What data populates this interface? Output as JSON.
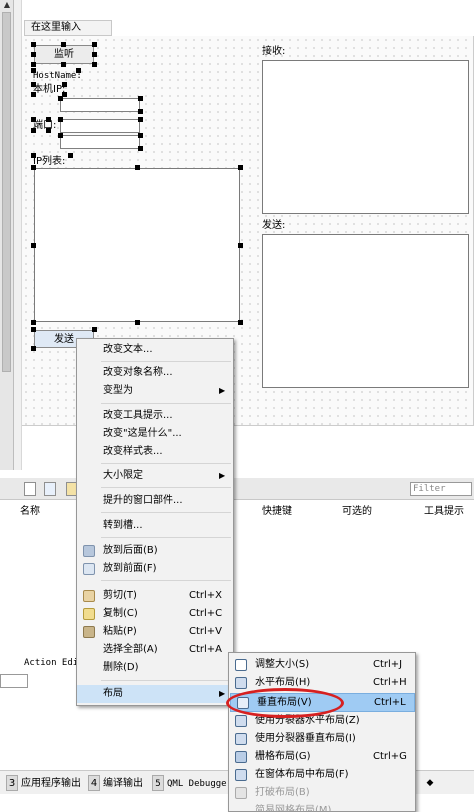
{
  "menubar": {
    "type_here": "在这里输入"
  },
  "form": {
    "listen_button": "监听",
    "hostname_label": "HostName:",
    "local_ip_label": "本机IP:",
    "port_label": "端口:",
    "ip_list_label": "IP列表:",
    "receive_label": "接收:",
    "send_label": "发送:",
    "send_button": "发送"
  },
  "dock": {
    "filter_placeholder": "Filter",
    "columns": [
      "名称",
      "快捷键",
      "可选的",
      "工具提示"
    ],
    "action_editor_tab": "Action Edi"
  },
  "statusbar": {
    "items": [
      {
        "num": "3",
        "label": "应用程序输出"
      },
      {
        "num": "4",
        "label": "编译输出"
      },
      {
        "num": "5",
        "label": "QML Debugger"
      }
    ]
  },
  "context_menu": {
    "items": [
      {
        "label": "改变文本...",
        "shortcut": ""
      },
      {
        "label": "改变对象名称...",
        "shortcut": ""
      },
      {
        "label": "变型为",
        "shortcut": ""
      },
      {
        "label": "改变工具提示...",
        "shortcut": ""
      },
      {
        "label": "改变\"这是什么\"...",
        "shortcut": ""
      },
      {
        "label": "改变样式表...",
        "shortcut": ""
      },
      {
        "label": "大小限定",
        "shortcut": ""
      },
      {
        "label": "提升的窗口部件...",
        "shortcut": ""
      },
      {
        "label": "转到槽...",
        "shortcut": ""
      },
      {
        "label": "放到后面(B)",
        "shortcut": ""
      },
      {
        "label": "放到前面(F)",
        "shortcut": ""
      },
      {
        "label": "剪切(T)",
        "shortcut": "Ctrl+X"
      },
      {
        "label": "复制(C)",
        "shortcut": "Ctrl+C"
      },
      {
        "label": "粘贴(P)",
        "shortcut": "Ctrl+V"
      },
      {
        "label": "选择全部(A)",
        "shortcut": "Ctrl+A"
      },
      {
        "label": "删除(D)",
        "shortcut": ""
      },
      {
        "label": "布局",
        "shortcut": ""
      }
    ]
  },
  "layout_submenu": {
    "items": [
      {
        "label": "调整大小(S)",
        "shortcut": "Ctrl+J"
      },
      {
        "label": "水平布局(H)",
        "shortcut": "Ctrl+H"
      },
      {
        "label": "垂直布局(V)",
        "shortcut": "Ctrl+L"
      },
      {
        "label": "使用分裂器水平布局(Z)",
        "shortcut": ""
      },
      {
        "label": "使用分裂器垂直布局(I)",
        "shortcut": ""
      },
      {
        "label": "栅格布局(G)",
        "shortcut": "Ctrl+G"
      },
      {
        "label": "在窗体布局中布局(F)",
        "shortcut": ""
      },
      {
        "label": "打破布局(B)",
        "shortcut": ""
      },
      {
        "label": "简易网格布局(M)",
        "shortcut": ""
      }
    ]
  },
  "colors": {
    "highlight": "#9fcbf3",
    "annotation_circle": "#d62020"
  }
}
